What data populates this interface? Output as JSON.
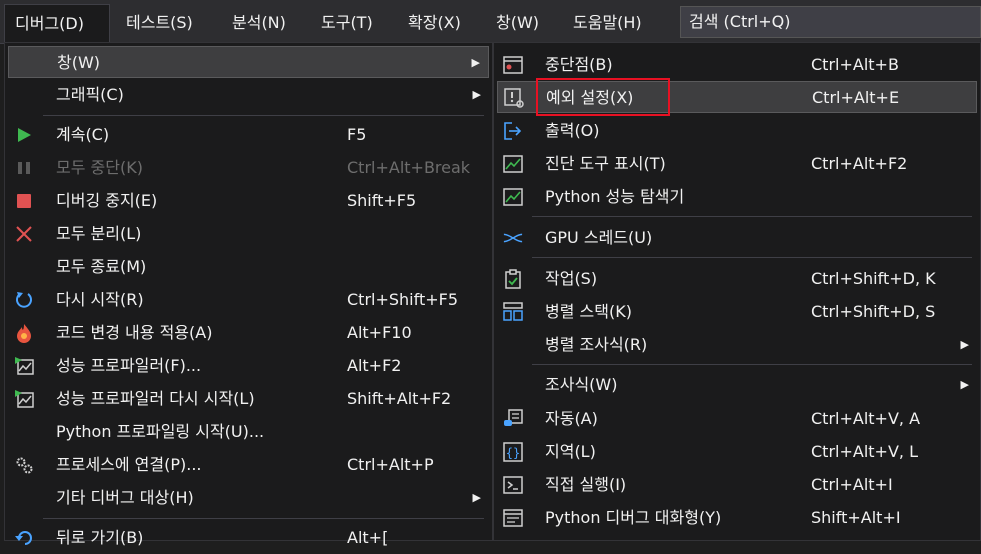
{
  "menubar": {
    "items": [
      "디버그(D)",
      "테스트(S)",
      "분석(N)",
      "도구(T)",
      "확장(X)",
      "창(W)",
      "도움말(H)"
    ],
    "search": "검색 (Ctrl+Q)"
  },
  "debug_menu": {
    "items": [
      {
        "label": "창(W)",
        "shortcut": "",
        "icon": "none"
      },
      {
        "label": "그래픽(C)",
        "shortcut": "",
        "icon": "none"
      },
      {
        "label": "계속(C)",
        "shortcut": "F5",
        "icon": "play-icon"
      },
      {
        "label": "모두 중단(K)",
        "shortcut": "Ctrl+Alt+Break",
        "icon": "pause-icon"
      },
      {
        "label": "디버깅 중지(E)",
        "shortcut": "Shift+F5",
        "icon": "stop-icon"
      },
      {
        "label": "모두 분리(L)",
        "shortcut": "",
        "icon": "detach-icon"
      },
      {
        "label": "모두 종료(M)",
        "shortcut": "",
        "icon": "none"
      },
      {
        "label": "다시 시작(R)",
        "shortcut": "Ctrl+Shift+F5",
        "icon": "restart-icon"
      },
      {
        "label": "코드 변경 내용 적용(A)",
        "shortcut": "Alt+F10",
        "icon": "hot-reload-icon"
      },
      {
        "label": "성능 프로파일러(F)...",
        "shortcut": "Alt+F2",
        "icon": "profiler-icon"
      },
      {
        "label": "성능 프로파일러 다시 시작(L)",
        "shortcut": "Shift+Alt+F2",
        "icon": "profiler-restart-icon"
      },
      {
        "label": "Python 프로파일링 시작(U)...",
        "shortcut": "",
        "icon": "none"
      },
      {
        "label": "프로세스에 연결(P)...",
        "shortcut": "Ctrl+Alt+P",
        "icon": "attach-process-icon"
      },
      {
        "label": "기타 디버그 대상(H)",
        "shortcut": "",
        "icon": "none"
      },
      {
        "label": "뒤로 가기(B)",
        "shortcut": "Alt+[",
        "icon": "back-icon"
      }
    ]
  },
  "window_menu": {
    "items": [
      {
        "label": "중단점(B)",
        "shortcut": "Ctrl+Alt+B",
        "icon": "breakpoints-icon"
      },
      {
        "label": "예외 설정(X)",
        "shortcut": "Ctrl+Alt+E",
        "icon": "exception-settings-icon"
      },
      {
        "label": "출력(O)",
        "shortcut": "",
        "icon": "output-icon"
      },
      {
        "label": "진단 도구 표시(T)",
        "shortcut": "Ctrl+Alt+F2",
        "icon": "diagnostic-tools-icon"
      },
      {
        "label": "Python 성능 탐색기",
        "shortcut": "",
        "icon": "performance-explorer-icon"
      },
      {
        "label": "GPU 스레드(U)",
        "shortcut": "",
        "icon": "gpu-threads-icon"
      },
      {
        "label": "작업(S)",
        "shortcut": "Ctrl+Shift+D, K",
        "icon": "tasks-icon"
      },
      {
        "label": "병렬 스택(K)",
        "shortcut": "Ctrl+Shift+D, S",
        "icon": "parallel-stacks-icon"
      },
      {
        "label": "병렬 조사식(R)",
        "shortcut": "",
        "icon": "none"
      },
      {
        "label": "조사식(W)",
        "shortcut": "",
        "icon": "none"
      },
      {
        "label": "자동(A)",
        "shortcut": "Ctrl+Alt+V, A",
        "icon": "autos-icon"
      },
      {
        "label": "지역(L)",
        "shortcut": "Ctrl+Alt+V, L",
        "icon": "locals-icon"
      },
      {
        "label": "직접 실행(I)",
        "shortcut": "Ctrl+Alt+I",
        "icon": "immediate-window-icon"
      },
      {
        "label": "Python 디버그 대화형(Y)",
        "shortcut": "Shift+Alt+I",
        "icon": "python-interactive-icon"
      }
    ]
  },
  "colors": {
    "menu_bg": "#1b1b1c",
    "highlight": "#3e3e40",
    "callout_red": "#e81123",
    "play_green": "#3fb950",
    "stop_red": "#e05252"
  }
}
